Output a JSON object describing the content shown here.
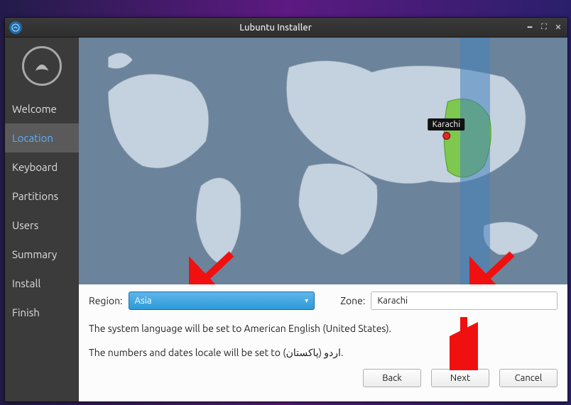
{
  "window": {
    "title": "Lubuntu Installer"
  },
  "sidebar": {
    "items": [
      {
        "label": "Welcome"
      },
      {
        "label": "Location",
        "active": true
      },
      {
        "label": "Keyboard"
      },
      {
        "label": "Partitions"
      },
      {
        "label": "Users"
      },
      {
        "label": "Summary"
      },
      {
        "label": "Install"
      },
      {
        "label": "Finish"
      }
    ]
  },
  "map": {
    "marker_label": "Karachi"
  },
  "form": {
    "region_label": "Region:",
    "region_value": "Asia",
    "zone_label": "Zone:",
    "zone_value": "Karachi"
  },
  "info": {
    "line1": "The system language will be set to American English (United States).",
    "line2": "The numbers and dates locale will be set to اردو (پاکستان)."
  },
  "buttons": {
    "back": "Back",
    "next": "Next",
    "cancel": "Cancel"
  }
}
